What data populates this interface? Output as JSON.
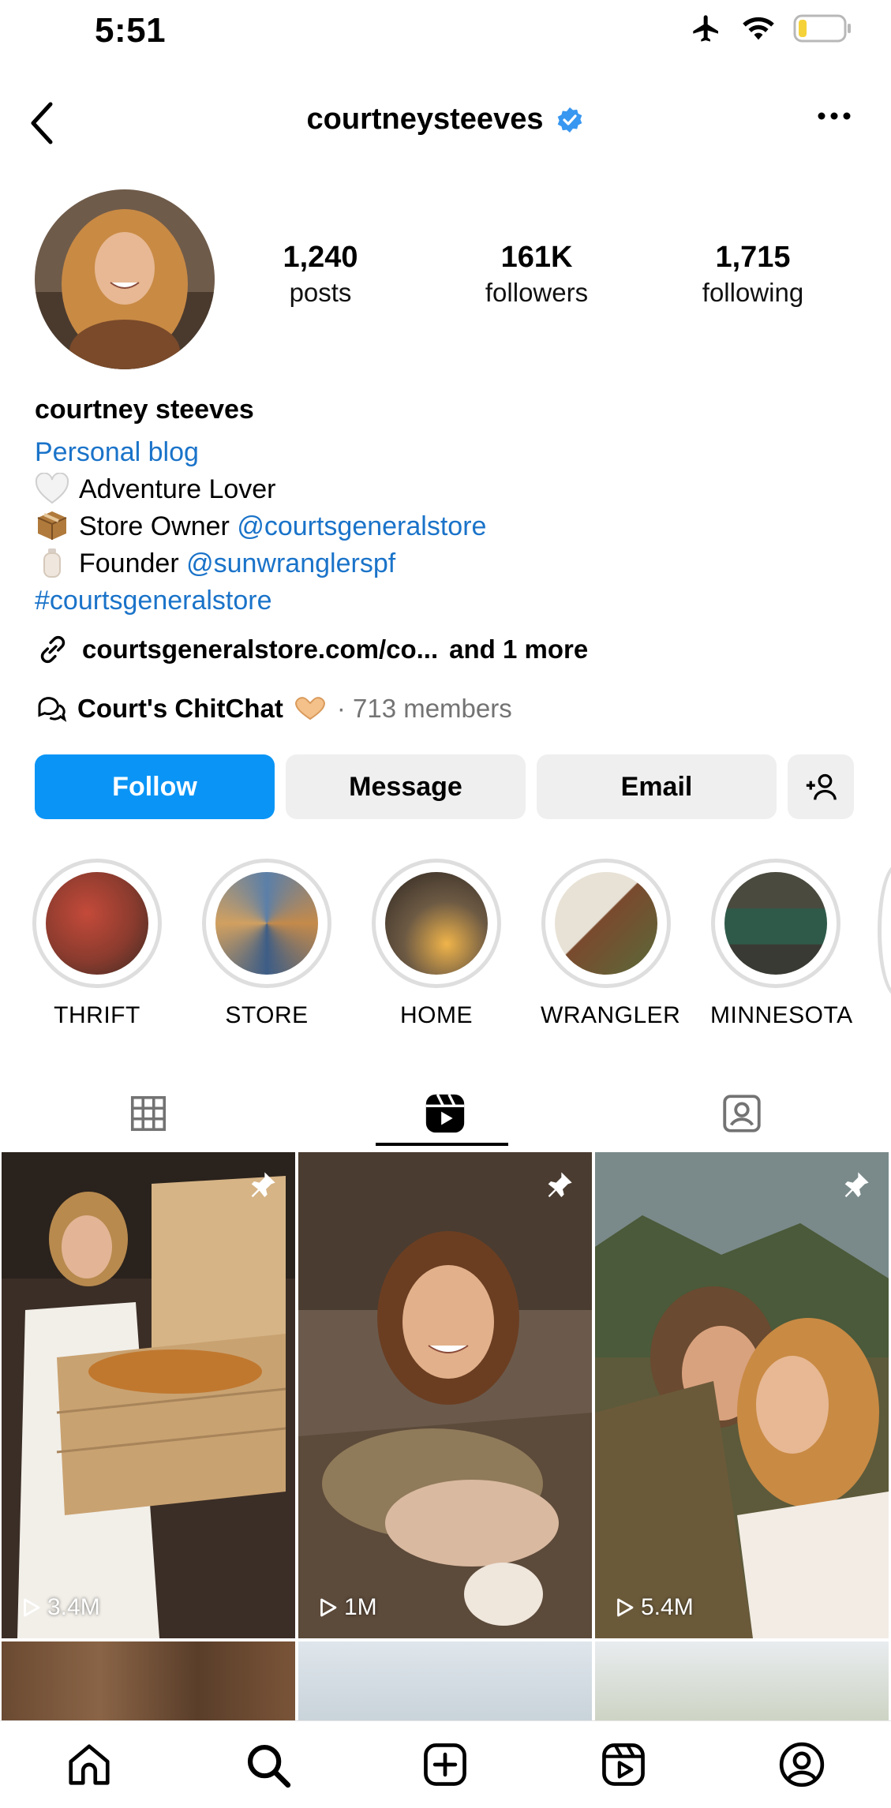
{
  "status": {
    "time": "5:51"
  },
  "header": {
    "username": "courtneysteeves"
  },
  "stats": [
    {
      "num": "1,240",
      "label": "posts"
    },
    {
      "num": "161K",
      "label": "followers"
    },
    {
      "num": "1,715",
      "label": "following"
    }
  ],
  "profile": {
    "name": "courtney steeves",
    "category": "Personal blog",
    "bio": [
      {
        "text": "Adventure Lover",
        "mention": ""
      },
      {
        "text": "Store Owner",
        "mention": "@courtsgeneralstore"
      },
      {
        "text": "Founder",
        "mention": "@sunwranglerspf"
      }
    ],
    "hashtag": "#courtsgeneralstore",
    "link": "courtsgeneralstore.com/co...",
    "link_more": "and 1 more",
    "channel": "Court's ChitChat",
    "channel_members": "· 713 members"
  },
  "buttons": {
    "follow": "Follow",
    "message": "Message",
    "email": "Email"
  },
  "highlights": [
    {
      "label": "THRIFT",
      "color": "#8a3b2e"
    },
    {
      "label": "STORE",
      "color": "#5b7fa8"
    },
    {
      "label": "HOME",
      "color": "#6d5a44"
    },
    {
      "label": "WRANGLER",
      "color": "#7a4a2e"
    },
    {
      "label": "MINNESOTA",
      "color": "#2f5a4a"
    }
  ],
  "reels": [
    {
      "views": "3.4M",
      "color": "#3b2e26"
    },
    {
      "views": "1M",
      "color": "#6b5a4c"
    },
    {
      "views": "5.4M",
      "color": "#5c5a3a"
    }
  ],
  "colors": {
    "accent": "#0a95f6",
    "link": "#1a73c9",
    "verified": "#3897f0"
  }
}
